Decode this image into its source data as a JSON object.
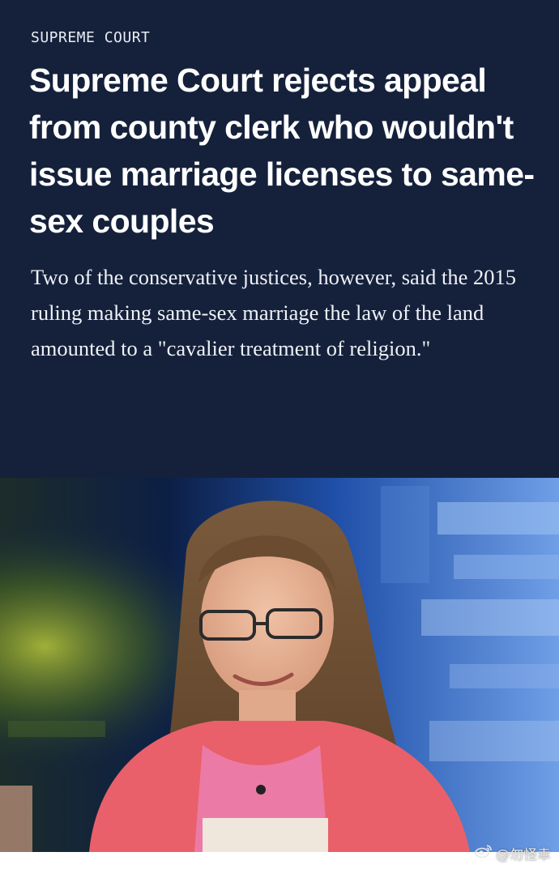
{
  "article": {
    "section": "SUPREME COURT",
    "headline": "Supreme Court rejects appeal from county clerk who wouldn't issue marriage licenses to same-sex couples",
    "dek": "Two of the conservative justices, however, said the 2015 ruling making same-sex marriage the law of the land amounted to a \"cavalier treatment of religion.\""
  },
  "watermark": {
    "text": "@勿怪幸",
    "icon": "weibo-icon"
  },
  "colors": {
    "hero_background": "#15213b",
    "text_primary": "#ffffff"
  }
}
